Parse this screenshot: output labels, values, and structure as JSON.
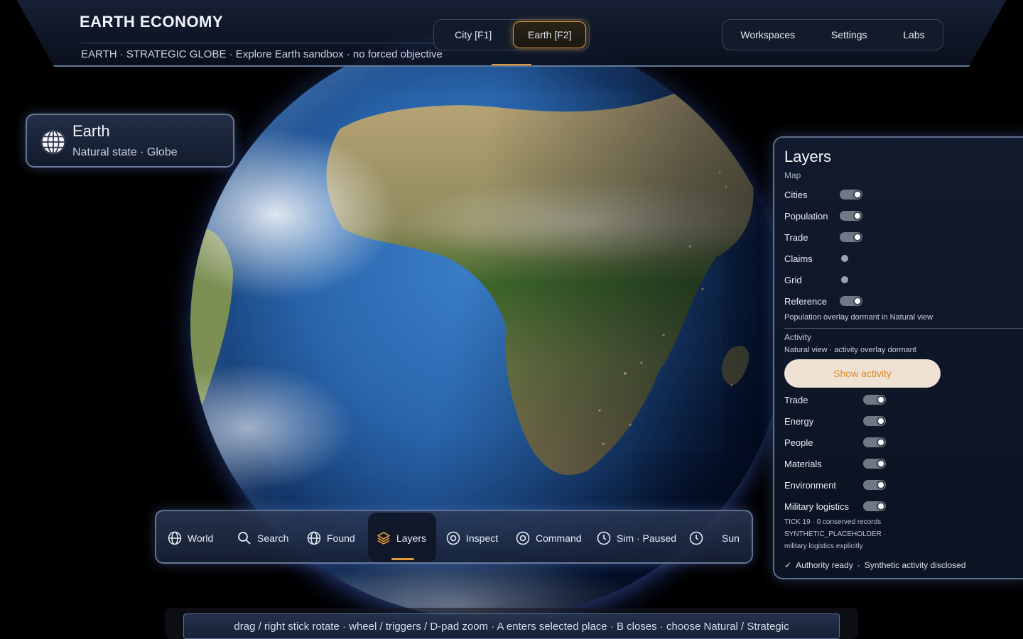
{
  "header": {
    "title": "EARTH ECONOMY",
    "subtitle": "EARTH · STRATEGIC GLOBE · Explore Earth sandbox · no forced objective"
  },
  "mode_switch": {
    "city_label": "City  [F1]",
    "earth_label": "Earth  [F2]",
    "active": "Earth  [F2]"
  },
  "topnav": {
    "items": [
      "Workspaces",
      "Settings",
      "Labs"
    ]
  },
  "place_card": {
    "name": "Earth",
    "state": "Natural state · Globe",
    "icon": "globe-icon"
  },
  "layers": {
    "title": "Layers",
    "map_section": "Map",
    "map_items": [
      {
        "label": "Cities",
        "on": true
      },
      {
        "label": "Population",
        "on": true
      },
      {
        "label": "Trade",
        "on": true
      },
      {
        "label": "Claims",
        "on": false
      },
      {
        "label": "Grid",
        "on": false
      },
      {
        "label": "Reference",
        "on": true
      }
    ],
    "map_note": "Population overlay dormant in Natural view",
    "activity_section": "Activity",
    "activity_note": "Natural view · activity overlay dormant",
    "show_activity_label": "Show activity",
    "activity_items": [
      {
        "label": "Trade",
        "on": true
      },
      {
        "label": "Energy",
        "on": true
      },
      {
        "label": "People",
        "on": true
      },
      {
        "label": "Materials",
        "on": true
      },
      {
        "label": "Environment",
        "on": true
      },
      {
        "label": "Military logistics",
        "on": true
      }
    ],
    "fine_lines": [
      "TICK 19 · 0 conserved records",
      "SYNTHETIC_PLACEHOLDER ·",
      "military logistics explicitly"
    ],
    "status_check": "✓",
    "status_ready": "Authority ready",
    "status_sep": "·",
    "status_disclosed": "Synthetic activity disclosed"
  },
  "toolbar": {
    "items": [
      {
        "label": "World",
        "icon": "globe-icon"
      },
      {
        "label": "Search",
        "icon": "search-icon"
      },
      {
        "label": "Found",
        "icon": "globe-icon"
      },
      {
        "label": "Layers",
        "icon": "layers-icon"
      },
      {
        "label": "Inspect",
        "icon": "target-icon"
      },
      {
        "label": "Command",
        "icon": "target-icon"
      },
      {
        "label": "Sim · Paused",
        "icon": "clock-icon"
      },
      {
        "label": "Sun",
        "icon": "clock-icon"
      }
    ],
    "active": "Layers",
    "accent": "#e39a3b"
  },
  "hint": {
    "text": "drag / right stick rotate · wheel / triggers / D-pad zoom · A enters selected place · B closes · choose Natural / Strategic"
  }
}
